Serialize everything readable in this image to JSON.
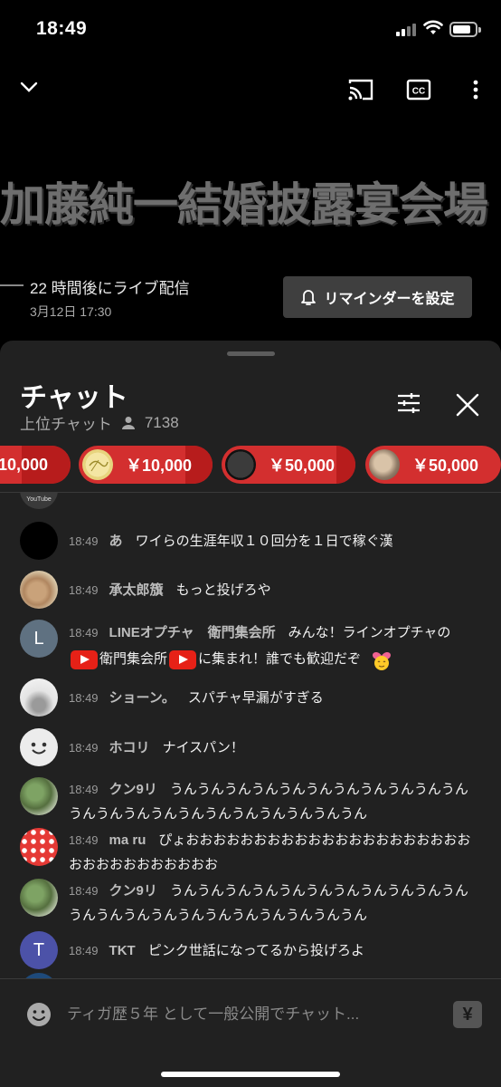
{
  "status_bar": {
    "time": "18:49"
  },
  "video": {
    "big_title": "加藤純一結婚披露宴会場",
    "live_text": "22 時間後にライブ配信",
    "live_date": "3月12日 17:30",
    "reminder_label": "リマインダーを設定"
  },
  "chat": {
    "title": "チャット",
    "subtitle": "上位チャット",
    "viewer_count": "7138",
    "ticker": [
      {
        "amount": "10,000",
        "color": "#d32f2f"
      },
      {
        "amount": "￥10,000",
        "color": "#d32f2f"
      },
      {
        "amount": "￥50,000",
        "color": "#d32f2f"
      },
      {
        "amount": "￥50,000",
        "color": "#d32f2f"
      }
    ],
    "partial_avatar_label": "YouTube",
    "messages": [
      {
        "time": "18:49",
        "author": "あ",
        "text": "ワイらの生涯年収１０回分を１日で稼ぐ漢"
      },
      {
        "time": "18:49",
        "author": "承太郎籏",
        "text": "もっと投げろや"
      },
      {
        "time": "18:49",
        "author": "LINEオプチャ　衛門集会所",
        "text_parts": [
          "みんな！ラインオプチャの",
          "衛門集会所",
          "に集まれ！誰でも歓迎だぞ"
        ],
        "avatar_letter": "L"
      },
      {
        "time": "18:49",
        "author": "ショーン。",
        "text": "スパチャ早漏がすぎる"
      },
      {
        "time": "18:49",
        "author": "ホコリ",
        "text": "ナイスパン！"
      },
      {
        "time": "18:49",
        "author": "クン9リ",
        "text": "うんうんうんうんうんうんうんうんうんうんうんうんうんうんうんうんうんうんうんうんうんうん"
      },
      {
        "time": "18:49",
        "author": "ma ru",
        "text": "ぴょおおおおおおおおおおおおおおおおおおおおおおおおおおおおおおおお"
      },
      {
        "time": "18:49",
        "author": "クン9リ",
        "text": "うんうんうんうんうんうんうんうんうんうんうんうんうんうんうんうんうんうんうんうんうんうん"
      },
      {
        "time": "18:49",
        "author": "TKT",
        "text": "ピンク世話になってるから投げろよ",
        "avatar_letter": "T"
      }
    ],
    "input_placeholder": "ティガ歴５年 として一般公開でチャット...",
    "superchat_symbol": "¥"
  },
  "colors": {
    "accent_red": "#d32f2f",
    "panel_bg": "#212121",
    "avatar_l": "#5f7181",
    "avatar_t": "#4c52a8"
  },
  "icons": [
    "chevron-down-icon",
    "cast-icon",
    "cc-icon",
    "more-vert-icon",
    "bell-icon",
    "person-icon",
    "filter-icon",
    "close-icon",
    "emoji-icon",
    "superchat-icon",
    "youtube-icon",
    "heart-face-icon"
  ]
}
